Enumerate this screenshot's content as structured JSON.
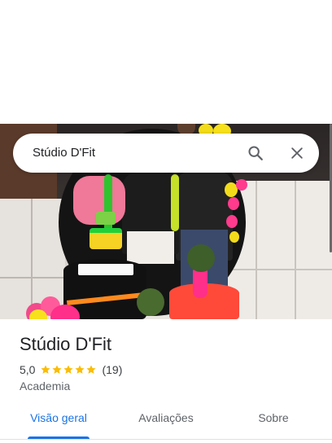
{
  "search": {
    "query": "Stúdio D'Fit",
    "search_icon": "search-icon",
    "close_icon": "close-icon"
  },
  "place": {
    "name": "Stúdio D'Fit",
    "rating": "5,0",
    "rating_stars": 5,
    "review_count": "(19)",
    "category": "Academia"
  },
  "tabs": [
    {
      "label": "Visão geral",
      "active": true
    },
    {
      "label": "Avaliações",
      "active": false
    },
    {
      "label": "Sobre",
      "active": false
    }
  ],
  "colors": {
    "accent": "#1a73e8",
    "star": "#fbbc04",
    "text_primary": "#202124",
    "text_secondary": "#5f6368"
  }
}
